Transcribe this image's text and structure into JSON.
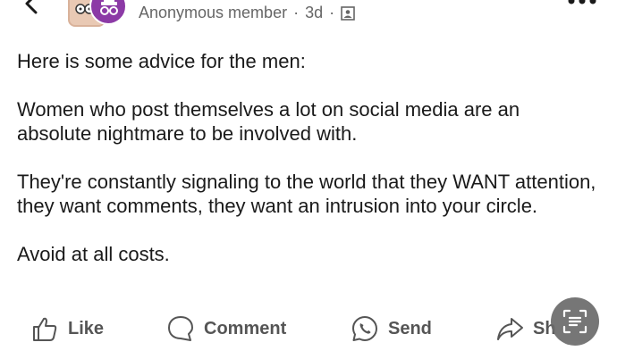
{
  "header": {
    "author": "Anonymous member",
    "separator": "·",
    "time": "3d",
    "visibility_icon": "contacts-icon",
    "back_icon": "chevron-left-icon",
    "more_icon": "more-horizontal-icon"
  },
  "post": {
    "paragraphs": [
      "Here is some advice for the men:",
      "Women who post themselves a lot on social media are an absolute nightmare to be involved with.",
      "They're constantly signaling to the world that they WANT attention, they want comments, they want an intrusion into your circle.",
      "Avoid at all costs."
    ]
  },
  "actions": {
    "like": "Like",
    "comment": "Comment",
    "send": "Send",
    "share": "Sh"
  },
  "fab": {
    "icon": "text-scan-icon"
  },
  "colors": {
    "secondary_text": "#666666",
    "avatar_purple": "#8c3aa6",
    "fab_gray": "#6b6b6b"
  }
}
